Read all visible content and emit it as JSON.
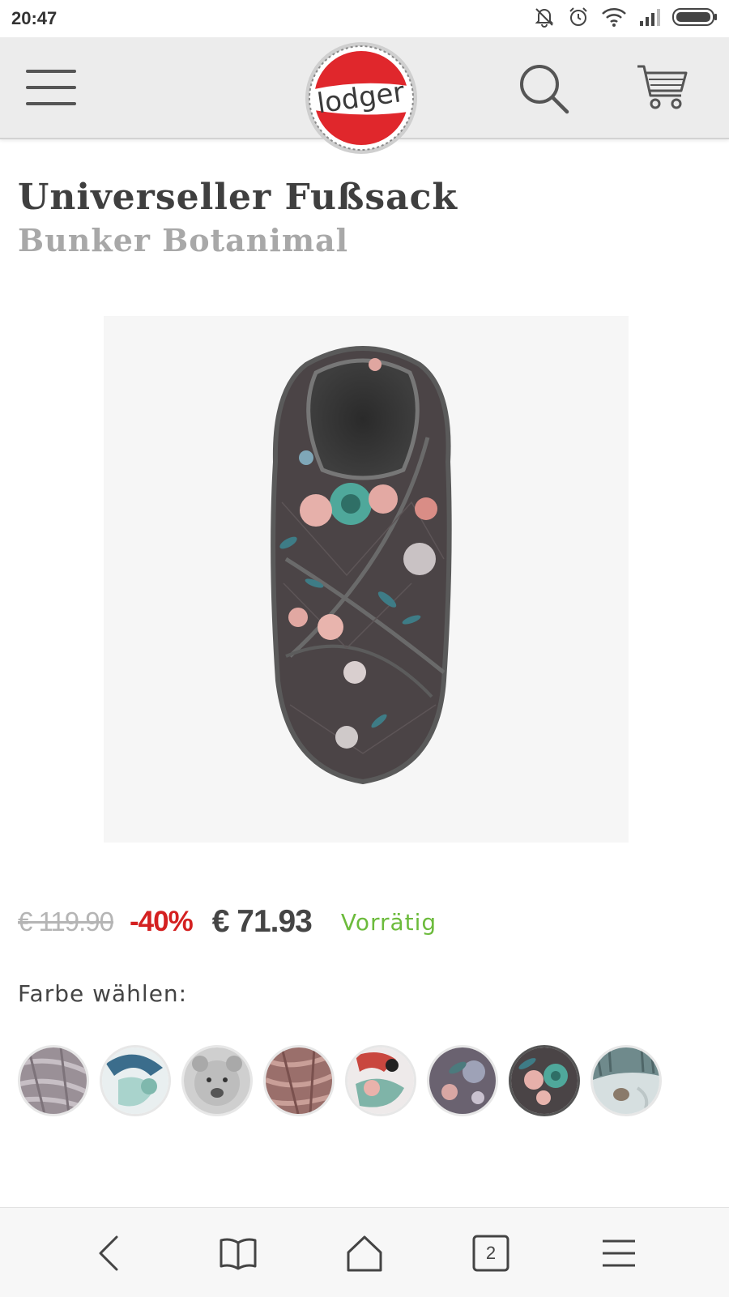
{
  "status_bar": {
    "time": "20:47",
    "icons": [
      "mute-icon",
      "alarm-icon",
      "wifi-icon",
      "signal-icon",
      "battery-icon"
    ]
  },
  "header": {
    "logo_text": "lodger",
    "icons": [
      "hamburger-menu-icon",
      "search-icon",
      "cart-icon"
    ]
  },
  "product": {
    "title": "Universeller Fußsack",
    "subtitle": "Bunker Botanimal",
    "old_price": "€ 119.90",
    "discount": "-40%",
    "price": "€ 71.93",
    "stock_status": "Vorrätig"
  },
  "color_picker": {
    "label": "Farbe wählen:",
    "selected_index": 6,
    "swatch_count": 8
  },
  "browser_nav": {
    "tab_count": "2",
    "icons": [
      "back-icon",
      "bookmarks-icon",
      "home-icon",
      "tabs-icon",
      "menu-icon"
    ]
  },
  "colors": {
    "discount_red": "#d42020",
    "stock_green": "#6cbb3c",
    "logo_red": "#e0272c"
  }
}
